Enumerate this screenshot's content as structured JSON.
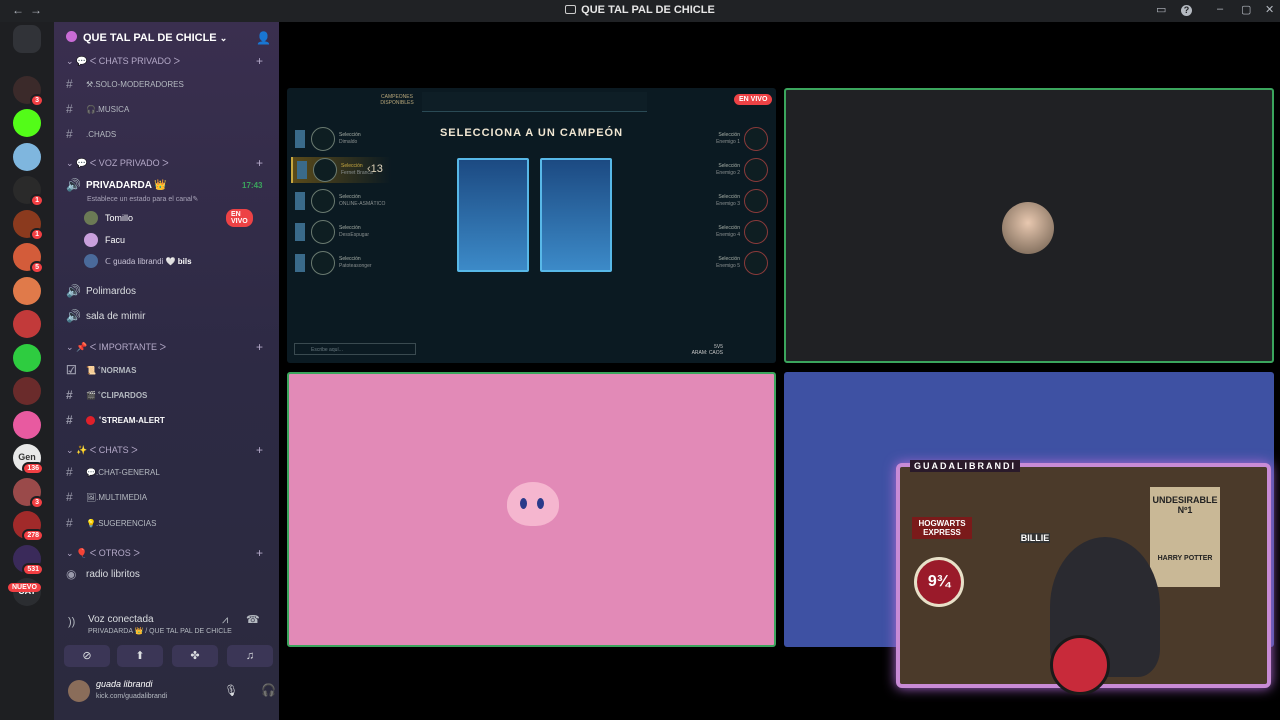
{
  "window": {
    "title": "QUE TAL PAL DE CHICLE"
  },
  "servers": [
    {
      "name": "discord-home",
      "color": "#5865f2"
    },
    {
      "name": "server-1",
      "color": "#3b2a2a",
      "badge": "3"
    },
    {
      "name": "kick",
      "color": "#53fc18"
    },
    {
      "name": "server-3",
      "color": "#7fb6de"
    },
    {
      "name": "server-4",
      "color": "#2a2a2a",
      "badge": "1"
    },
    {
      "name": "server-5",
      "color": "#8b3a1e",
      "badge": "1"
    },
    {
      "name": "server-6",
      "color": "#d35c3a",
      "badge": "5"
    },
    {
      "name": "server-7",
      "color": "#e07a4a"
    },
    {
      "name": "server-8",
      "color": "#c23a3a"
    },
    {
      "name": "server-9",
      "color": "#2ecc40"
    },
    {
      "name": "server-10",
      "color": "#6a2b2b"
    },
    {
      "name": "server-11",
      "color": "#e85aa0"
    },
    {
      "name": "gen",
      "color": "#e8e8e8",
      "label": "Gen",
      "badge": "136"
    },
    {
      "name": "server-13",
      "color": "#9a4a4a",
      "badge": "3"
    },
    {
      "name": "server-14",
      "color": "#a12a2a",
      "badge": "278"
    },
    {
      "name": "server-15",
      "color": "#3a2a5a",
      "badge": "531"
    },
    {
      "name": "cat",
      "color": "#2b2d31",
      "label": "CAT"
    }
  ],
  "new_label": "NUEVO",
  "guild": {
    "name": "QUE TAL PAL DE CHICLE"
  },
  "categories": {
    "chats_privado": "ᐸ CHATS PRIVADO ᐳ",
    "voz_privado": "ᐸ VOZ PRIVADO ᐳ",
    "importante": "ᐸ IMPORTANTE ᐳ",
    "chats": "ᐸ CHATS ᐳ",
    "otros": "ᐸ OTROS ᐳ"
  },
  "channels": {
    "solo_moderadores": "⚒.SOLO-MODERADORES",
    "musica": "🎧.MUSICA",
    "chads": ".CHADS",
    "privadarda": "PRIVADARDA 👑",
    "privadarda_time": "17:43",
    "status_hint": "Establece un estado para el canal",
    "polimardos": "Polimardos",
    "sala_de_mimir": "sala de mimir",
    "normas": "NORMAS",
    "clipardos": "CLIPARDOS",
    "stream_alert": "STREAM-ALERT",
    "chat_general": ".CHAT-GENERAL",
    "multimedia": ".MULTIMEDIA",
    "sugerencias": ".SUGERENCIAS",
    "radio_libritos": "radio libritos"
  },
  "voice_users": [
    {
      "name": "Tomillo",
      "live": "EN VIVO"
    },
    {
      "name": "Facu"
    },
    {
      "name": "ᑕ guada librandi",
      "tag": "🤍 bils"
    }
  ],
  "voice_connected": {
    "title": "Voz conectada",
    "subtitle": "PRIVADARDA 👑 / QUE TAL PAL DE CHICLE"
  },
  "user": {
    "name": "guada librandi",
    "status": "kick.com/guadalibrandi"
  },
  "stream1": {
    "live": "EN VIVO",
    "top_label": "CAMPEONES DISPONIBLES",
    "heading": "SELECCIONA A UN CAMPEÓN",
    "timer": "13",
    "allies": [
      {
        "a": "Selección",
        "b": "Dimaldo"
      },
      {
        "a": "Selección",
        "b": "Fernet Branca"
      },
      {
        "a": "Selección",
        "b": "ONLINE-ASMÁTICO"
      },
      {
        "a": "Selección",
        "b": "DessEspugar"
      },
      {
        "a": "Selección",
        "b": "Patoteasonger"
      }
    ],
    "enemies": [
      {
        "a": "Selección",
        "b": "Enemigo 1"
      },
      {
        "a": "Selección",
        "b": "Enemigo 2"
      },
      {
        "a": "Selección",
        "b": "Enemigo 3"
      },
      {
        "a": "Selección",
        "b": "Enemigo 4"
      },
      {
        "a": "Selección",
        "b": "Enemigo 5"
      }
    ],
    "chat_placeholder": "Escribe aquí...",
    "mode": "5V5",
    "map": "ARAM: CAOS"
  },
  "cam": {
    "handle": "GUADALIBRANDI",
    "poster1": "UNDESIRABLE Nº1",
    "poster2": "HARRY POTTER",
    "poster3": "HOGWARTS EXPRESS",
    "poster4": "BILLIE",
    "platform": "9¾"
  },
  "colors": {
    "accent": "#5865f2",
    "live": "#ed4245",
    "speaking": "#3ba55d"
  }
}
